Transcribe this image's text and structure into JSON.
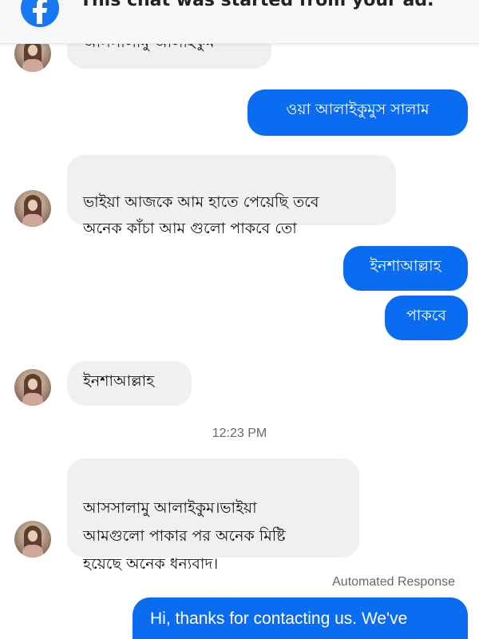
{
  "banner": {
    "text": "This chat was started from your ad.",
    "icon": "facebook-icon"
  },
  "messages": [
    {
      "side": "incoming",
      "text": "আসসালামু আলাইকুম"
    },
    {
      "side": "outgoing",
      "text": "ওয়া আলাইকুমুস সালাম"
    },
    {
      "side": "incoming",
      "text": "ভাইয়া আজকে আম হাতে পেয়েছি তবে\nঅনেক কাঁচা আম গুলো পাকবে তো"
    },
    {
      "side": "outgoing",
      "text": "ইনশাআল্লাহ"
    },
    {
      "side": "outgoing",
      "text": "পাকবে"
    },
    {
      "side": "incoming",
      "text": "ইনশাআল্লাহ"
    },
    {
      "side": "incoming",
      "text": "আসসালামু আলাইকুম।ভাইয়া\nআমগুলো পাকার পর অনেক মিষ্টি\nহয়েছে অনেক ধন্যবাদ।"
    },
    {
      "side": "outgoing",
      "text": "Hi, thanks for contacting us. We've"
    }
  ],
  "timestamp": "12:23 PM",
  "automated_label": "Automated Response",
  "colors": {
    "outgoing_bubble": "#0a6cf0",
    "incoming_bubble": "#eef0f2",
    "banner_icon": "#1877f2"
  }
}
